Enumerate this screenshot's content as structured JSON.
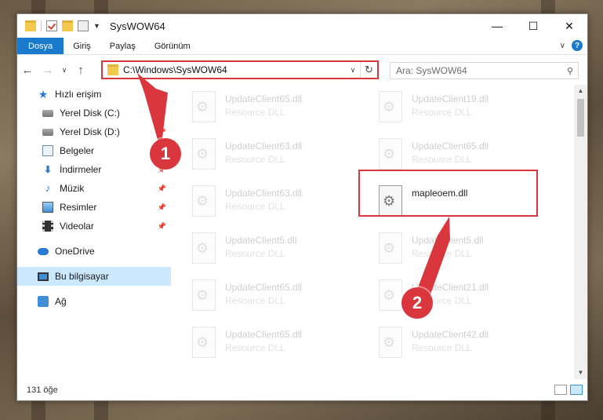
{
  "window": {
    "title": "SysWOW64",
    "controls": {
      "minimize": "—",
      "maximize": "☐",
      "close": "✕"
    }
  },
  "ribbon": {
    "tabs": [
      {
        "label": "Dosya",
        "active": true
      },
      {
        "label": "Giriş"
      },
      {
        "label": "Paylaş"
      },
      {
        "label": "Görünüm"
      }
    ],
    "help": "?"
  },
  "address_bar": {
    "path": "C:\\Windows\\SysWOW64",
    "search_placeholder": "Ara: SysWOW64"
  },
  "sidebar": {
    "items": [
      {
        "label": "Hızlı erişim",
        "icon": "star-icon",
        "pinned": false,
        "selected": false
      },
      {
        "label": "Yerel Disk (C:)",
        "icon": "disk-icon",
        "pinned": true,
        "selected": false
      },
      {
        "label": "Yerel Disk (D:)",
        "icon": "disk-icon",
        "pinned": true,
        "selected": false
      },
      {
        "label": "Belgeler",
        "icon": "documents-icon",
        "pinned": true,
        "selected": false
      },
      {
        "label": "İndirmeler",
        "icon": "download-icon",
        "pinned": true,
        "selected": false
      },
      {
        "label": "Müzik",
        "icon": "music-icon",
        "pinned": true,
        "selected": false
      },
      {
        "label": "Resimler",
        "icon": "pictures-icon",
        "pinned": true,
        "selected": false
      },
      {
        "label": "Videolar",
        "icon": "videos-icon",
        "pinned": true,
        "selected": false
      },
      {
        "label": "OneDrive",
        "icon": "cloud-icon",
        "pinned": false,
        "selected": false
      },
      {
        "label": "Bu bilgisayar",
        "icon": "computer-icon",
        "pinned": false,
        "selected": true
      },
      {
        "label": "Ağ",
        "icon": "network-icon",
        "pinned": false,
        "selected": false
      }
    ]
  },
  "files": [
    {
      "name": "UpdateClient65.dll",
      "type": "Resource DLL",
      "faded": true
    },
    {
      "name": "UpdateClient19.dll",
      "type": "Resource DLL",
      "faded": true
    },
    {
      "name": "UpdateClient63.dll",
      "type": "Resource DLL",
      "faded": true
    },
    {
      "name": "UpdateClient65.dll",
      "type": "Resource DLL",
      "faded": true
    },
    {
      "name": "UpdateClient63.dll",
      "type": "Resource DLL",
      "faded": true
    },
    {
      "name": "mapleoem.dll",
      "type": "",
      "faded": false
    },
    {
      "name": "UpdateClient5.dll",
      "type": "Resource DLL",
      "faded": true
    },
    {
      "name": "UpdateClient5.dll",
      "type": "Resource DLL",
      "faded": true
    },
    {
      "name": "UpdateClient65.dll",
      "type": "Resource DLL",
      "faded": true
    },
    {
      "name": "UpdateClient21.dll",
      "type": "Resource DLL",
      "faded": true
    },
    {
      "name": "UpdateClient65.dll",
      "type": "Resource DLL",
      "faded": true
    },
    {
      "name": "UpdateClient42.dll",
      "type": "Resource DLL",
      "faded": true
    }
  ],
  "status": {
    "item_count": "131 öğe"
  },
  "callouts": [
    {
      "number": "1"
    },
    {
      "number": "2"
    }
  ],
  "colors": {
    "accent": "#1979ca",
    "highlight": "#d9373d",
    "selection": "#cce8ff"
  }
}
